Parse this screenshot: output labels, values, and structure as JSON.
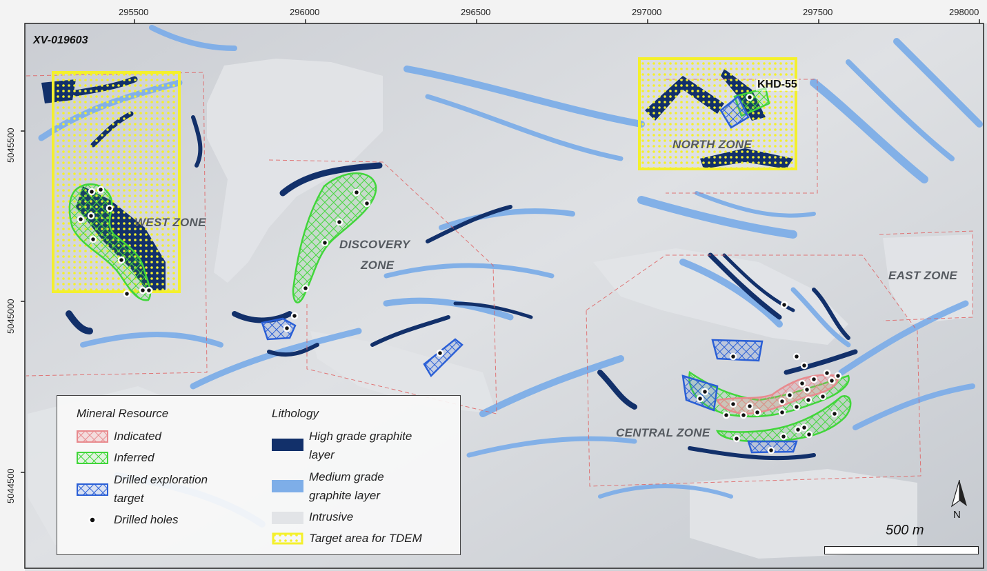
{
  "map_id": "XV-019603",
  "x_ticks": [
    "295500",
    "296000",
    "296500",
    "297000",
    "297500",
    "298000"
  ],
  "y_ticks": [
    "5045500",
    "5045000",
    "5044500"
  ],
  "zones": {
    "west": "WEST ZONE",
    "discovery_line1": "DISCOVERY",
    "discovery_line2": "ZONE",
    "north": "NORTH ZONE",
    "east": "EAST ZONE",
    "central": "CENTRAL ZONE"
  },
  "drillhole_label": "KHD-55",
  "legend": {
    "mineral_resource_title": "Mineral Resource",
    "indicated": "Indicated",
    "inferred": "Inferred",
    "drilled_target_line1": "Drilled exploration",
    "drilled_target_line2": "target",
    "drilled_holes": "Drilled holes",
    "lithology_title": "Lithology",
    "high_grade_line1": "High grade graphite",
    "high_grade_line2": "layer",
    "medium_grade_line1": "Medium grade",
    "medium_grade_line2": "graphite layer",
    "intrusive": "Intrusive",
    "tdem_target": "Target area for TDEM"
  },
  "scale_label": "500 m",
  "north_label": "N",
  "colors": {
    "high_grade": "#12306a",
    "medium_grade": "#7eaee8",
    "intrusive": "#d6d8dc",
    "indicated": "#e88a8e",
    "inferred": "#41d63a",
    "drilled_target": "#2a5fd6",
    "tdem": "#f4f02c"
  }
}
